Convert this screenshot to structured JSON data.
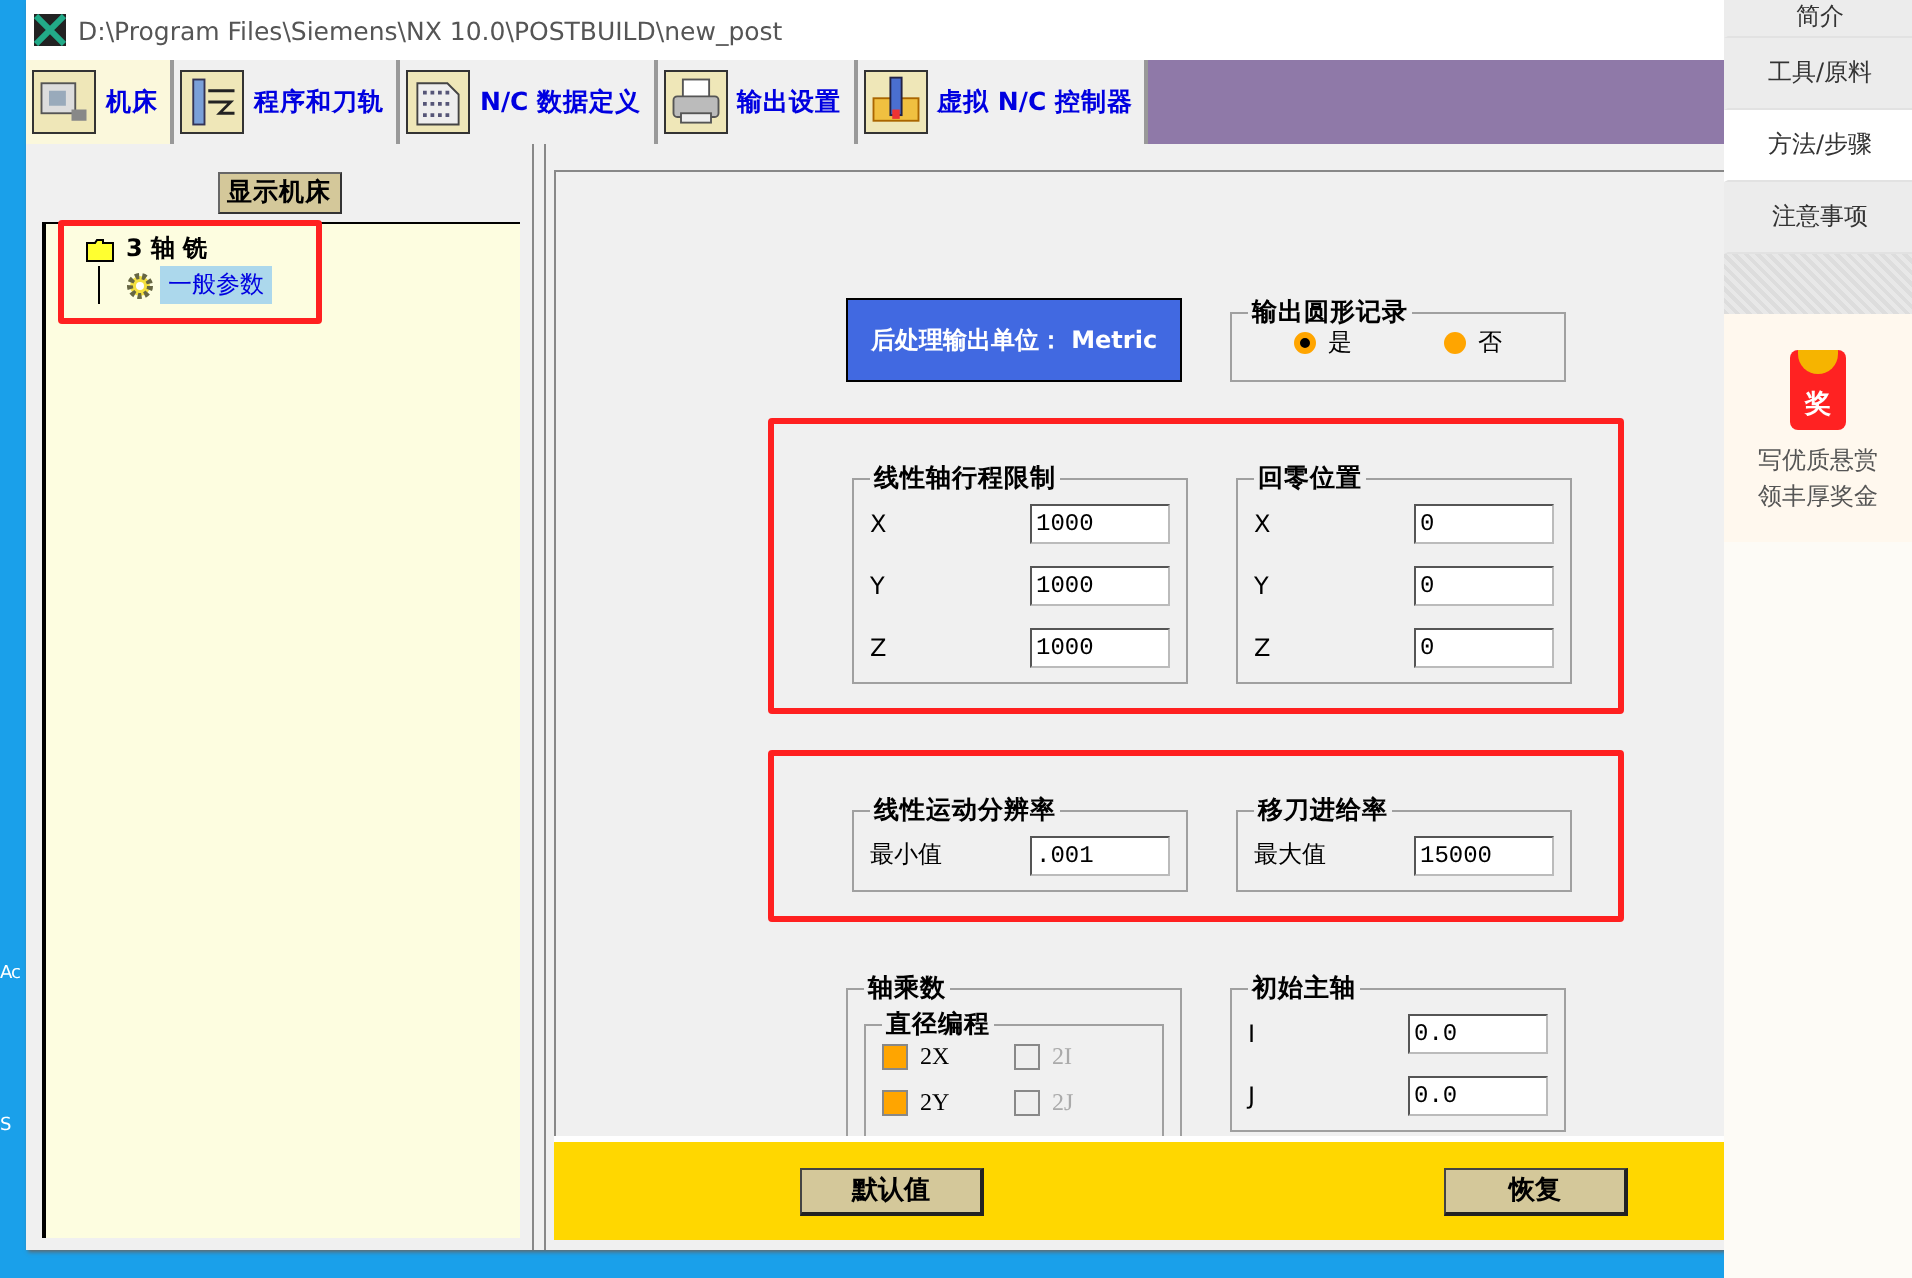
{
  "desktop": {
    "labels": [
      "Ac",
      "S"
    ]
  },
  "window": {
    "title": "D:\\Program Files\\Siemens\\NX 10.0\\POSTBUILD\\new_post"
  },
  "tabs": [
    {
      "label": "机床",
      "selected": true,
      "kind": "machine"
    },
    {
      "label": "程序和刀轨",
      "selected": false,
      "kind": "program"
    },
    {
      "label": "N/C 数据定义",
      "selected": false,
      "kind": "data"
    },
    {
      "label": "输出设置",
      "selected": false,
      "kind": "printer"
    },
    {
      "label": "虚拟 N/C 控制器",
      "selected": false,
      "kind": "controller"
    }
  ],
  "machine_panel": {
    "button": "显示机床",
    "highlighted": true,
    "tree": [
      {
        "label": "3 轴 铣",
        "children": [
          {
            "label": "一般参数",
            "selected": true
          }
        ]
      }
    ]
  },
  "output_unit": "后处理输出单位： Metric",
  "graphics_output": {
    "title": "输出圆形记录",
    "options": [
      {
        "label": "是",
        "selected": true
      },
      {
        "label": "否",
        "selected": false
      }
    ]
  },
  "sections": [
    {
      "highlighted": true,
      "groups": [
        {
          "title": "线性轴行程限制",
          "fields": [
            {
              "label": "X",
              "value": "1000"
            },
            {
              "label": "Y",
              "value": "1000"
            },
            {
              "label": "Z",
              "value": "1000"
            }
          ]
        },
        {
          "title": "回零位置",
          "fields": [
            {
              "label": "X",
              "value": "0"
            },
            {
              "label": "Y",
              "value": "0"
            },
            {
              "label": "Z",
              "value": "0"
            }
          ]
        }
      ]
    },
    {
      "highlighted": true,
      "groups": [
        {
          "title": "线性运动分辨率",
          "fields": [
            {
              "label": "最小值",
              "value": ".001"
            }
          ]
        },
        {
          "title": "移刀进给率",
          "fields": [
            {
              "label": "最大值",
              "value": "15000"
            }
          ]
        }
      ]
    }
  ],
  "axis_multiplier": {
    "title": "轴乘数",
    "subgroup": "直径编程",
    "options": [
      {
        "label": "2X",
        "checked": true,
        "disabled": false
      },
      {
        "label": "2I",
        "checked": false,
        "disabled": true
      },
      {
        "label": "2Y",
        "checked": true,
        "disabled": false
      },
      {
        "label": "2J",
        "checked": false,
        "disabled": true
      }
    ]
  },
  "initial_spindle": {
    "title": "初始主轴",
    "fields": [
      {
        "label": "I",
        "value": "0.0"
      },
      {
        "label": "J",
        "value": "0.0"
      }
    ]
  },
  "footer_buttons": [
    "默认值",
    "恢复"
  ],
  "sidebar": {
    "items": [
      {
        "label": "简介",
        "selected": false
      },
      {
        "label": "工具/原料",
        "selected": false
      },
      {
        "label": "方法/步骤",
        "selected": true
      },
      {
        "label": "注意事项",
        "selected": false
      }
    ],
    "promo": {
      "badge": "奖",
      "lines": [
        "写优质悬赏",
        "领丰厚奖金"
      ]
    }
  }
}
